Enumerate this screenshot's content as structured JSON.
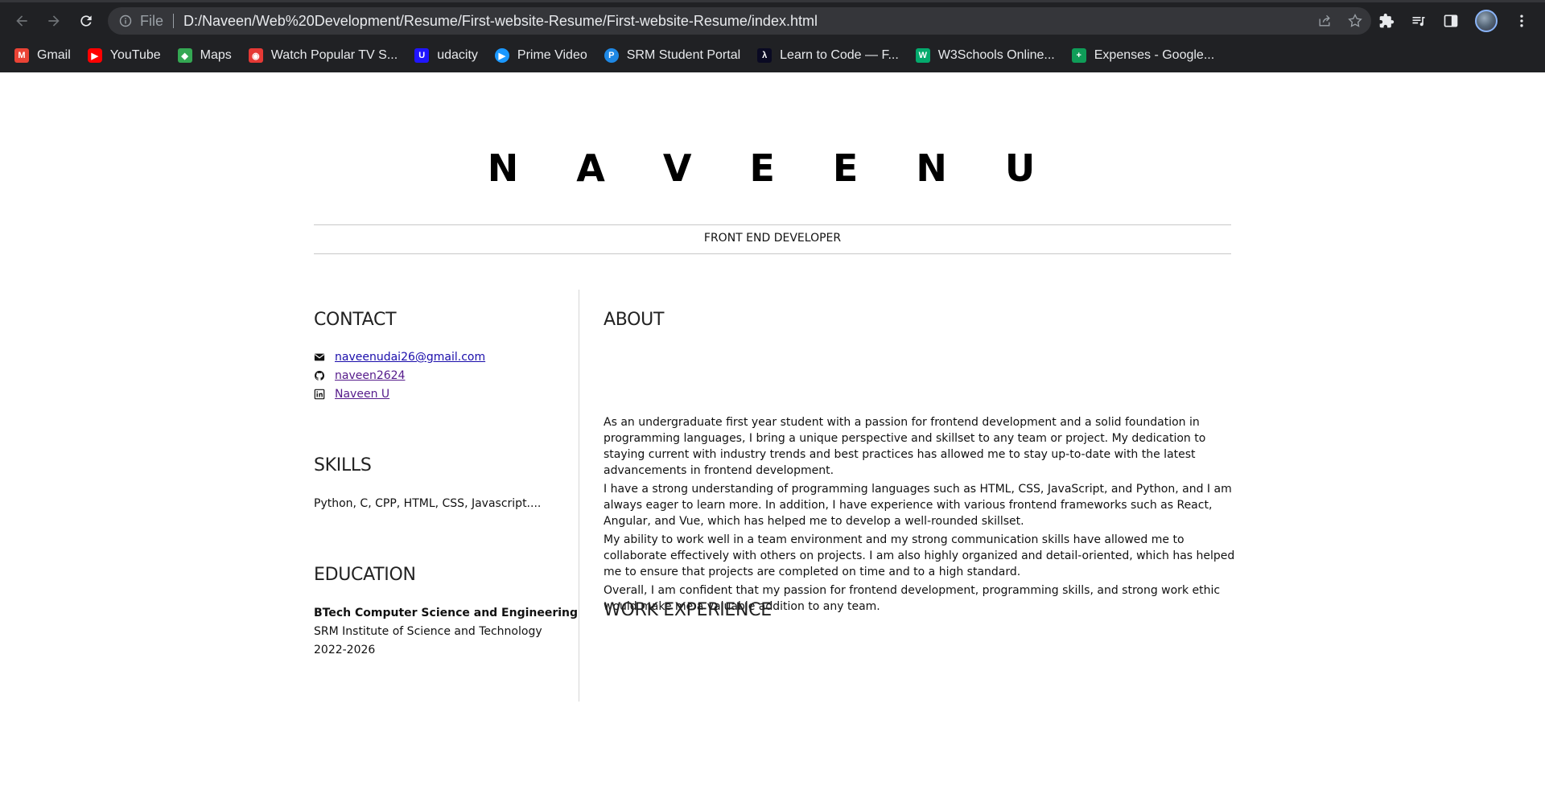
{
  "browser": {
    "omnibox": {
      "scheme_label": "File",
      "url": "D:/Naveen/Web%20Development/Resume/First-website-Resume/First-website-Resume/index.html"
    },
    "bookmarks": [
      {
        "label": "Gmail",
        "icon": "gmail-icon",
        "color": "#ea4335"
      },
      {
        "label": "YouTube",
        "icon": "youtube-icon",
        "color": "#ff0000"
      },
      {
        "label": "Maps",
        "icon": "maps-icon",
        "color": "#34a853"
      },
      {
        "label": "Watch Popular TV S...",
        "icon": "tv-icon",
        "color": "#e53935"
      },
      {
        "label": "udacity",
        "icon": "udacity-icon",
        "color": "#2015ff"
      },
      {
        "label": "Prime Video",
        "icon": "prime-video-icon",
        "color": "#1a98ff"
      },
      {
        "label": "SRM Student Portal",
        "icon": "srm-icon",
        "color": "#1e88e5"
      },
      {
        "label": "Learn to Code — F...",
        "icon": "freecodecamp-icon",
        "color": "#0a0a23"
      },
      {
        "label": "W3Schools Online...",
        "icon": "w3schools-icon",
        "color": "#04aa6d"
      },
      {
        "label": "Expenses - Google...",
        "icon": "sheets-icon",
        "color": "#0f9d58"
      }
    ]
  },
  "resume": {
    "name": "N A V E E N  U",
    "role": "FRONT END DEVELOPER",
    "contact": {
      "heading": "CONTACT",
      "email": "naveenudai26@gmail.com",
      "github": "naveen2624",
      "linkedin": "Naveen U"
    },
    "skills": {
      "heading": "SKILLS",
      "text": "Python, C, CPP, HTML, CSS, Javascript...."
    },
    "education": {
      "heading": "EDUCATION",
      "degree": "BTech Computer Science and Engineering",
      "institution": "SRM Institute of Science and Technology",
      "years": "2022-2026"
    },
    "about": {
      "heading": "ABOUT",
      "paragraphs": [
        "As an undergraduate first year student with a passion for frontend development and a solid foundation in programming languages, I bring a unique perspective and skillset to any team or project. My dedication to staying current with industry trends and best practices has allowed me to stay up-to-date with the latest advancements in frontend development.",
        "I have a strong understanding of programming languages such as HTML, CSS, JavaScript, and Python, and I am always eager to learn more. In addition, I have experience with various frontend frameworks such as React, Angular, and Vue, which has helped me to develop a well-rounded skillset.",
        "My ability to work well in a team environment and my strong communication skills have allowed me to collaborate effectively with others on projects. I am also highly organized and detail-oriented, which has helped me to ensure that projects are completed on time and to a high standard.",
        "Overall, I am confident that my passion for frontend development, programming skills, and strong work ethic would make me a valuable addition to any team."
      ]
    },
    "work": {
      "heading": "WORK EXPERIENCE"
    }
  }
}
